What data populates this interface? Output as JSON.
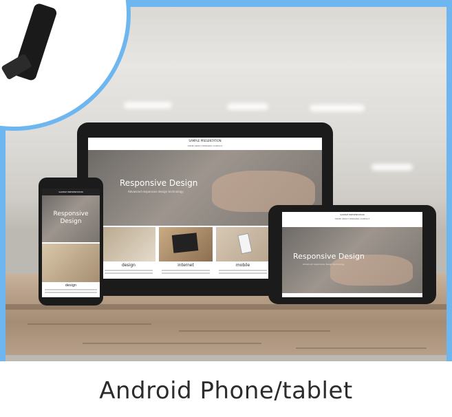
{
  "caption": "Android Phone/tablet",
  "tablet": {
    "site_name": "SAMPLE PRESENTATION",
    "nav": "HOME   ABOUT   PERSONS   CONTACT",
    "hero_title": "Responsive Design",
    "hero_subtitle": "Advanced responsive design technology",
    "cards": [
      {
        "label": "design"
      },
      {
        "label": "internet"
      },
      {
        "label": "mobile"
      }
    ]
  },
  "phone": {
    "site_name": "SAMPLE PRESENTATION",
    "hero_title_line1": "Responsive",
    "hero_title_line2": "Design",
    "card_label": "design"
  },
  "small_tablet": {
    "site_name": "SAMPLE PRESENTATION",
    "nav": "HOME  ABOUT  PERSONS  CONTACT",
    "hero_title": "Responsive Design",
    "hero_subtitle": "Advanced responsive design technology"
  },
  "colors": {
    "frame_blue": "#6db6f0",
    "device_black": "#1b1b1b",
    "wood": "#b59d86"
  }
}
